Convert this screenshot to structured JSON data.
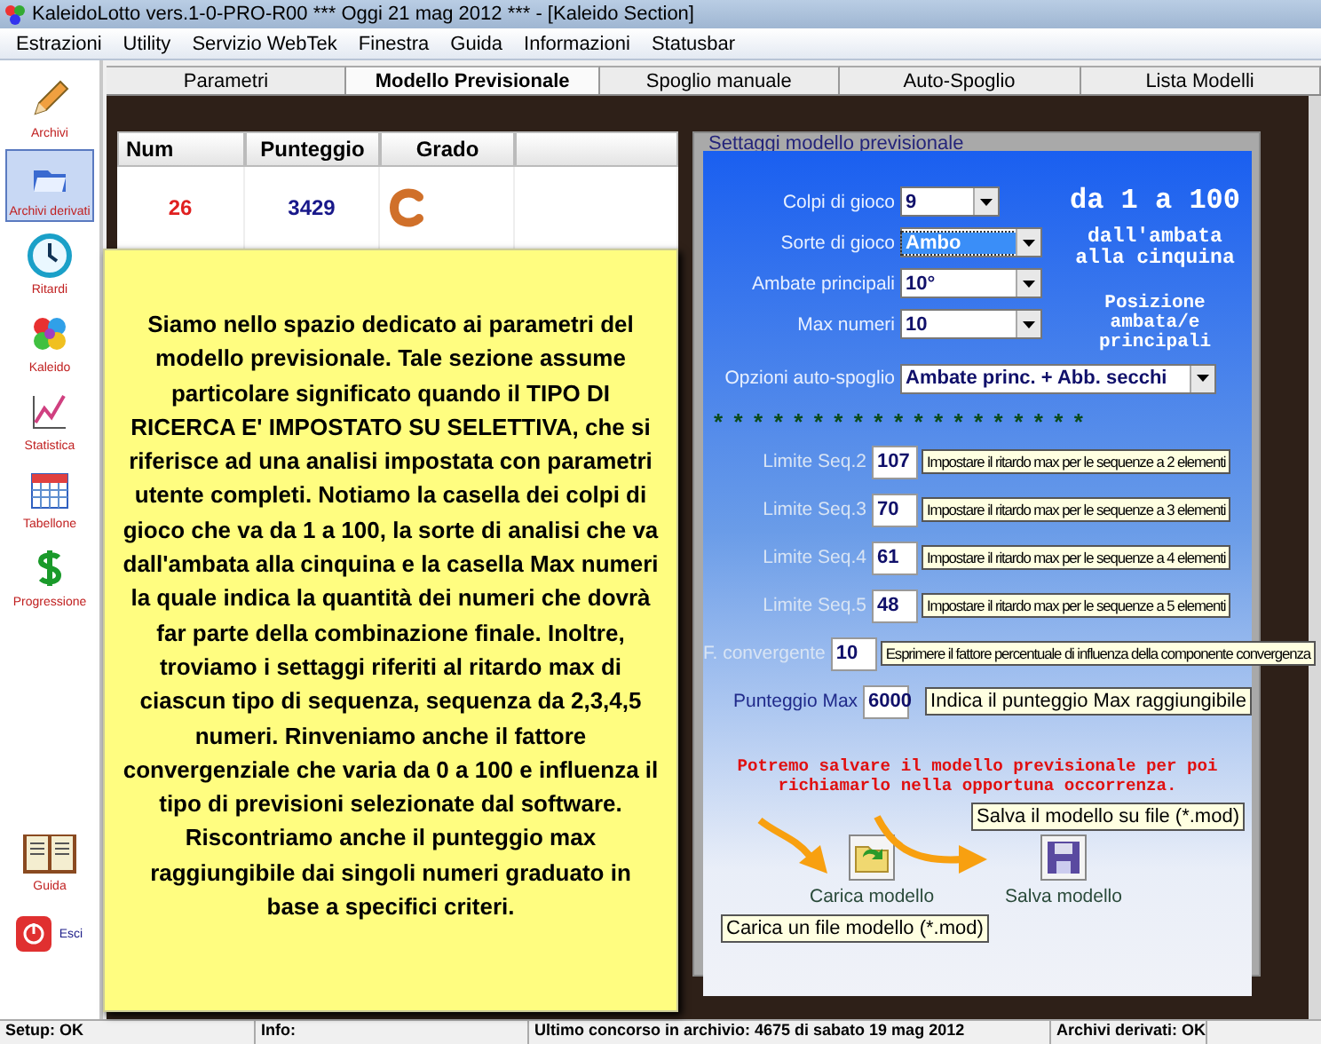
{
  "window": {
    "title": "KaleidoLotto vers.1-0-PRO-R00  ***  Oggi 21 mag 2012  ***   - [Kaleido Section]"
  },
  "menu": [
    "Estrazioni",
    "Utility",
    "Servizio WebTek",
    "Finestra",
    "Guida",
    "Informazioni",
    "Statusbar"
  ],
  "sidebar": {
    "items": [
      {
        "label": "Archivi",
        "selected": false
      },
      {
        "label": "Archivi derivati",
        "selected": true
      },
      {
        "label": "Ritardi",
        "selected": false
      },
      {
        "label": "Kaleido",
        "selected": false
      },
      {
        "label": "Statistica",
        "selected": false
      },
      {
        "label": "Tabellone",
        "selected": false
      },
      {
        "label": "Progressione",
        "selected": false
      }
    ],
    "bottom_items": [
      {
        "label": "Guida"
      },
      {
        "label": "Esci"
      }
    ]
  },
  "tabs": [
    {
      "label": "Parametri",
      "selected": false
    },
    {
      "label": "Modello Previsionale",
      "selected": true
    },
    {
      "label": "Spoglio manuale",
      "selected": false
    },
    {
      "label": "Auto-Spoglio",
      "selected": false
    },
    {
      "label": "Lista Modelli",
      "selected": false
    }
  ],
  "table": {
    "columns": [
      "Num",
      "Punteggio",
      "Grado",
      ""
    ],
    "rows": [
      {
        "num": "26",
        "punteggio": "3429"
      }
    ]
  },
  "note": "Siamo nello spazio dedicato ai parametri del modello previsionale. Tale sezione assume particolare significato quando il TIPO DI RICERCA E' IMPOSTATO SU SELETTIVA, che si riferisce ad una analisi impostata con parametri utente completi. Notiamo la casella dei colpi di gioco che va da 1 a 100, la sorte di analisi che va dall'ambata alla cinquina e la casella Max numeri la quale indica la quantità dei numeri che dovrà far parte della combinazione finale. Inoltre, troviamo i settaggi riferiti al ritardo max di ciascun tipo di sequenza, sequenza da 2,3,4,5 numeri. Rinveniamo anche il fattore convergenziale che varia da 0 a 100 e influenza il tipo di previsioni selezionate dal software. Riscontriamo anche il punteggio max raggiungibile dai singoli numeri graduato in base a specifici criteri.",
  "settings": {
    "title": "Settaggi modello previsionale",
    "dropdowns": [
      {
        "label": "Colpi di gioco",
        "value": "9",
        "focused": false
      },
      {
        "label": "Sorte di gioco",
        "value": "Ambo",
        "focused": true
      },
      {
        "label": "Ambate principali",
        "value": "10°",
        "focused": false
      },
      {
        "label": "Max numeri",
        "value": "10",
        "focused": false
      }
    ],
    "notes": [
      {
        "text": "da 1 a 100",
        "kind": "big"
      },
      {
        "text": "dall'ambata alla cinquina",
        "kind": "medium"
      },
      {
        "text": "Posizione ambata/e principali",
        "kind": "small"
      }
    ],
    "options": {
      "label": "Opzioni auto-spoglio",
      "value": "Ambate princ. + Abb. secchi"
    },
    "separator": "* * * * * * * * * * * * * * * * * * *",
    "limits": [
      {
        "label": "Limite Seq.2",
        "value": "107",
        "tooltip": "Impostare il ritardo max per le sequenze a 2 elementi",
        "dimmed": true
      },
      {
        "label": "Limite Seq.3",
        "value": "70",
        "tooltip": "Impostare il ritardo max per le sequenze a 3 elementi",
        "dimmed": true
      },
      {
        "label": "Limite Seq.4",
        "value": "61",
        "tooltip": "Impostare il ritardo max per le sequenze a 4 elementi",
        "dimmed": true
      },
      {
        "label": "Limite Seq.5",
        "value": "48",
        "tooltip": "Impostare il ritardo max per le sequenze a 5 elementi",
        "dimmed": true
      },
      {
        "label": "F. convergente",
        "value": "10",
        "tooltip": "Esprimere il fattore percentuale di influenza della componente convergenza",
        "dimmed": true
      },
      {
        "label": "Punteggio Max",
        "value": "6000",
        "tooltip": "Indica il punteggio Max raggiungibile",
        "dimmed": false
      }
    ],
    "save_note": "Potremo salvare il modello previsionale per poi richiamarlo nella opportuna occorrenza.",
    "save_tooltip": "Salva il modello su file (*.mod)",
    "load_button": "Carica modello",
    "save_button": "Salva modello",
    "load_tooltip": "Carica un file modello (*.mod)"
  },
  "status_bar": [
    "Setup: OK",
    "Info:",
    "Ultimo concorso in archivio: 4675 di sabato 19 mag 2012",
    "Archivi derivati: OK"
  ]
}
